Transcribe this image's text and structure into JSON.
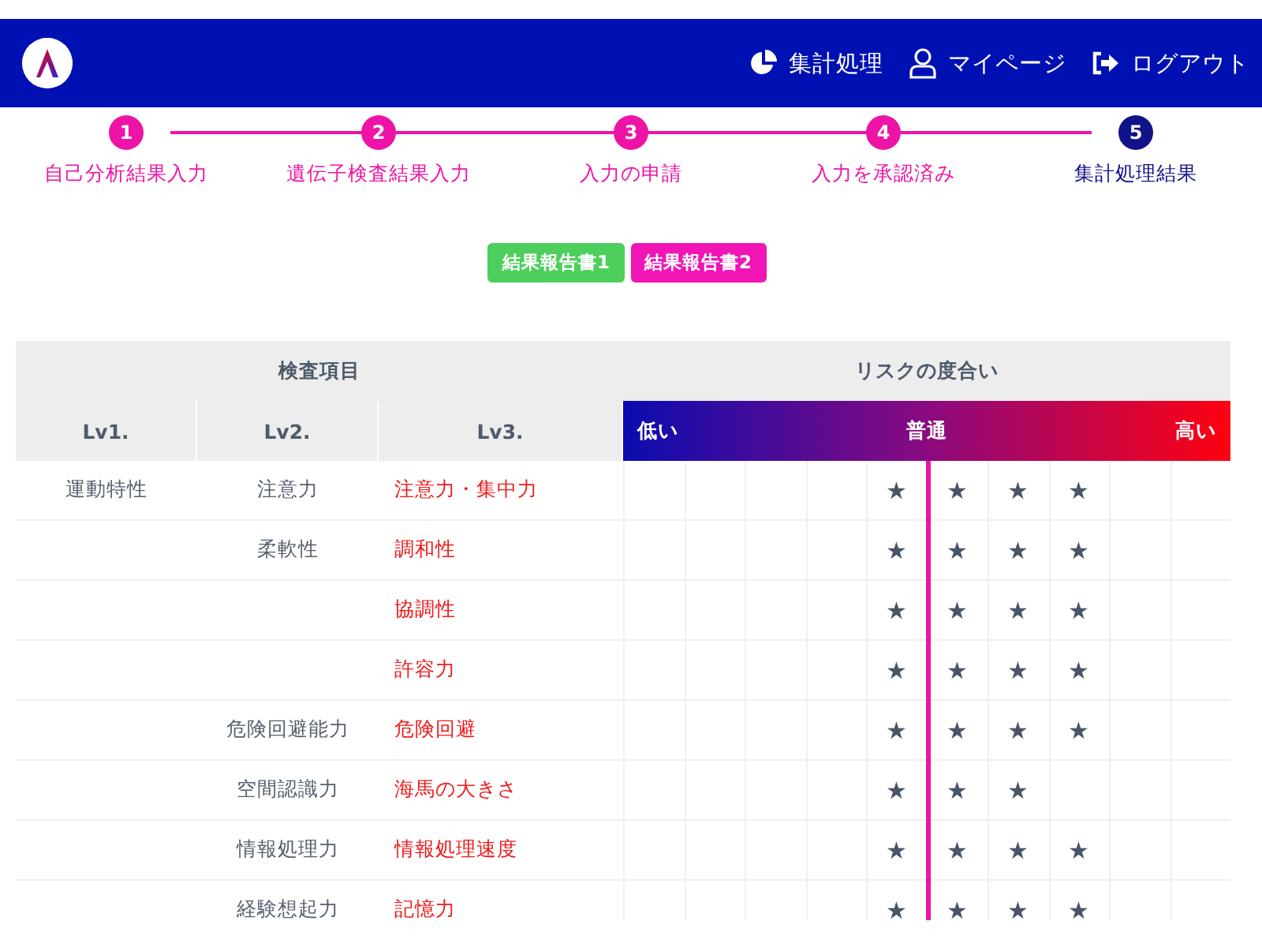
{
  "header": {
    "nav": [
      {
        "label": "集計処理"
      },
      {
        "label": "マイページ"
      },
      {
        "label": "ログアウト"
      }
    ]
  },
  "steps": [
    {
      "number": "1",
      "label": "自己分析結果入力",
      "current": false
    },
    {
      "number": "2",
      "label": "遺伝子検査結果入力",
      "current": false
    },
    {
      "number": "3",
      "label": "入力の申請",
      "current": false
    },
    {
      "number": "4",
      "label": "入力を承認済み",
      "current": false
    },
    {
      "number": "5",
      "label": "集計処理結果",
      "current": true
    }
  ],
  "report_buttons": [
    {
      "label": "結果報告書1",
      "color": "#4ccf5d"
    },
    {
      "label": "結果報告書2",
      "color": "#f015b4"
    }
  ],
  "table": {
    "group_headers": [
      "検査項目",
      "リスクの度合い"
    ],
    "columns": [
      "Lv1.",
      "Lv2.",
      "Lv3."
    ],
    "scale": [
      "低い",
      "普通",
      "高い"
    ],
    "rows": [
      {
        "lv1": "運動特性",
        "lv2": "注意力",
        "lv3": "注意力・集中力",
        "stars": 4
      },
      {
        "lv2": "柔軟性",
        "lv3": "調和性",
        "stars": 4
      },
      {
        "lv3": "協調性",
        "stars": 4
      },
      {
        "lv3": "許容力",
        "stars": 4
      },
      {
        "lv2": "危険回避能力",
        "lv3": "危険回避",
        "stars": 4
      },
      {
        "lv2": "空間認識力",
        "lv3": "海馬の大きさ",
        "stars": 3
      },
      {
        "lv2": "情報処理力",
        "lv3": "情報処理速度",
        "stars": 4
      },
      {
        "lv2": "経験想起力",
        "lv3": "記憶力",
        "stars": 4
      }
    ]
  }
}
